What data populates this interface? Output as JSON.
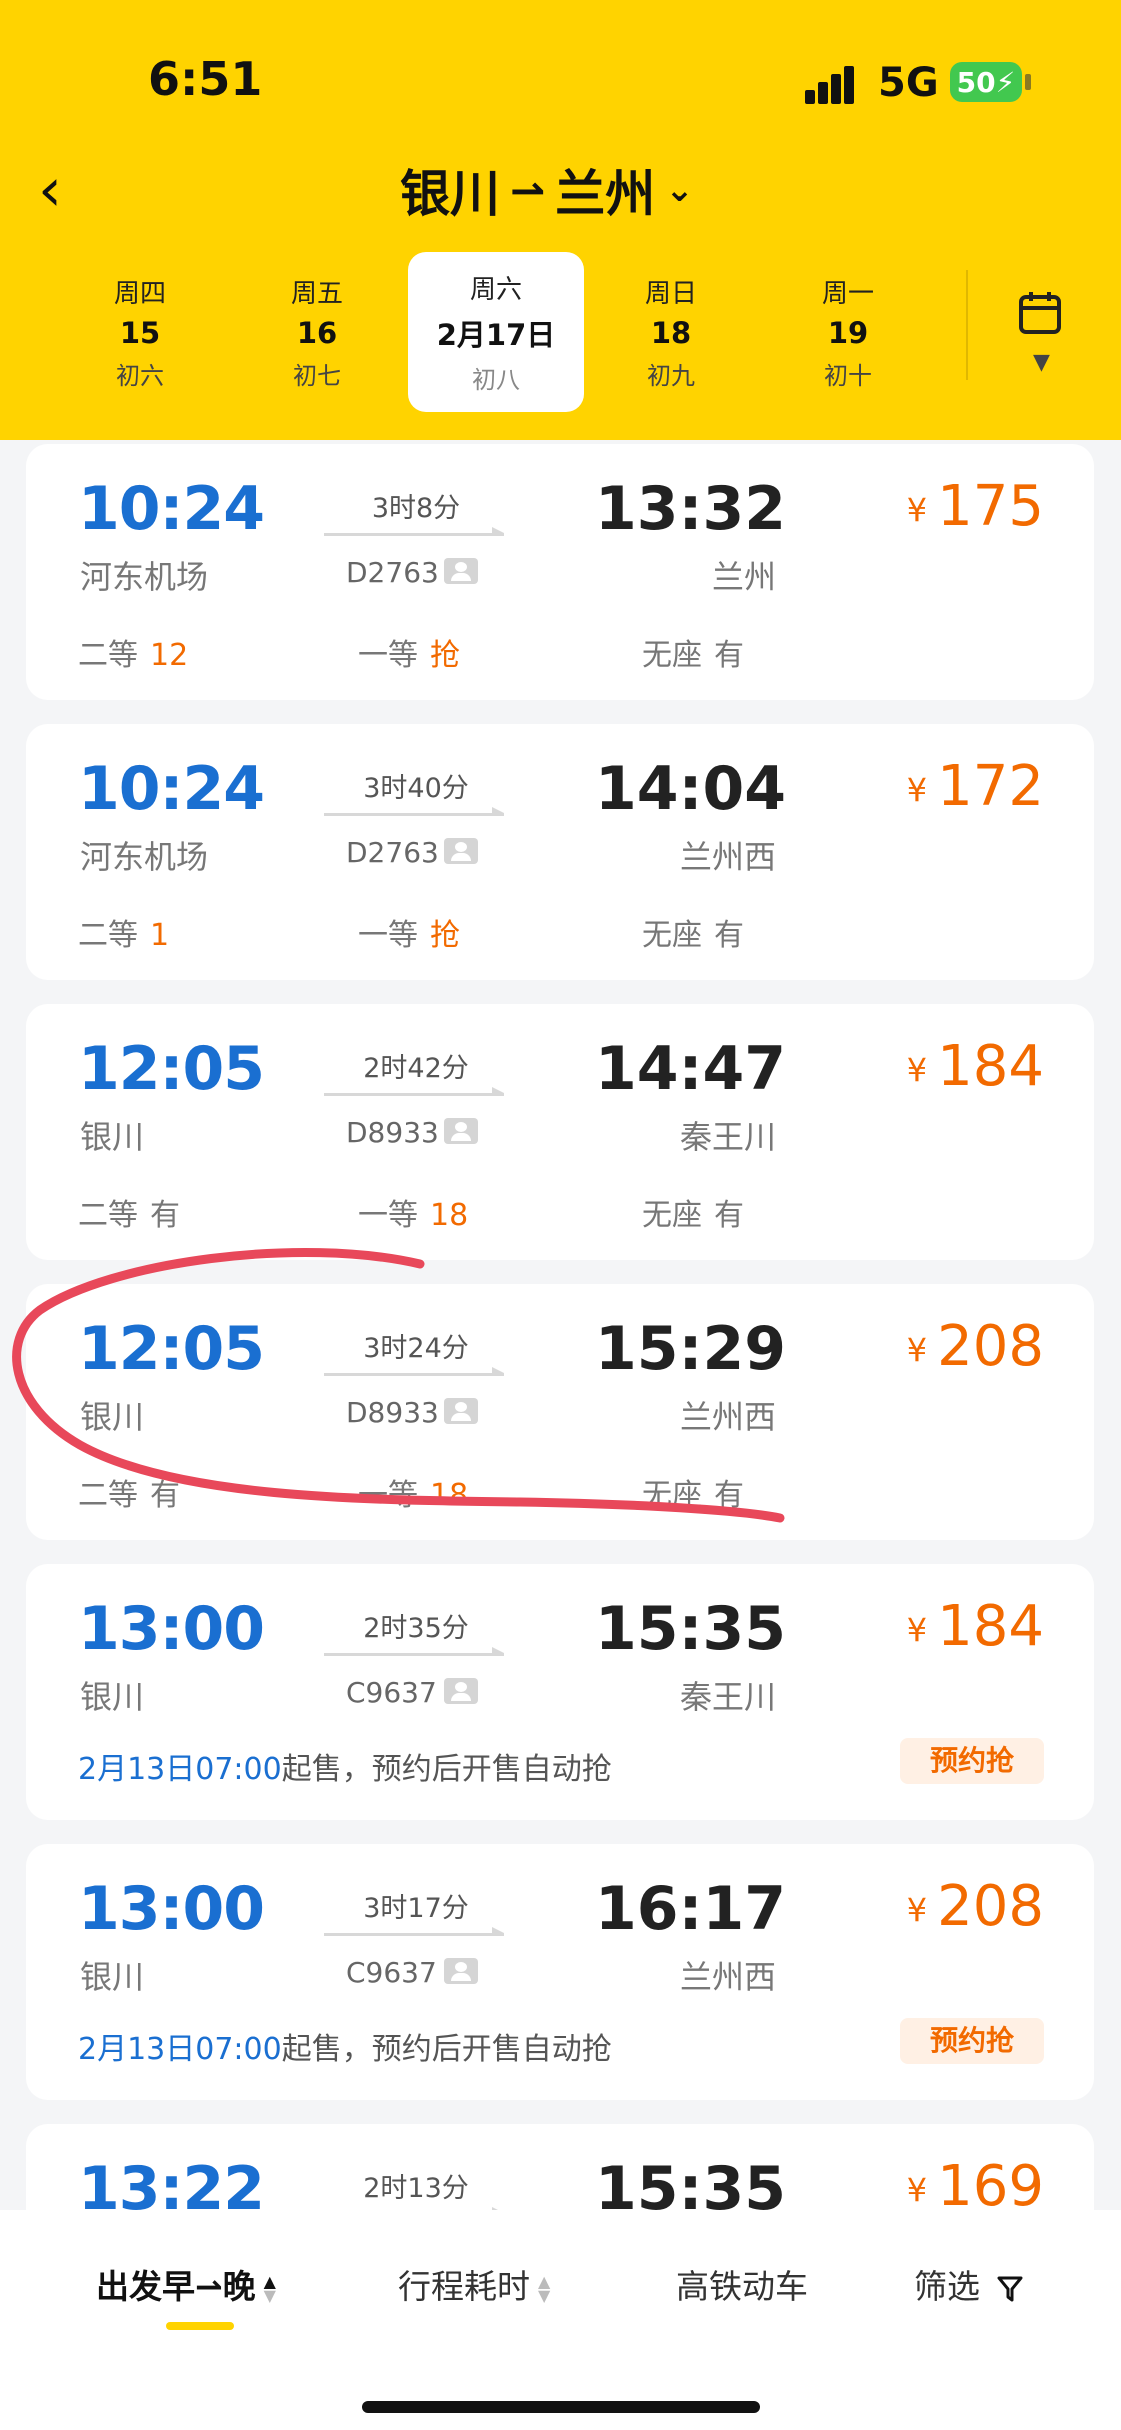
{
  "status": {
    "time": "6:51",
    "network": "5G",
    "battery": "50"
  },
  "header": {
    "from": "银川",
    "to": "兰州",
    "arrow": "⇀",
    "dates": [
      {
        "week": "周四",
        "day": "15",
        "lunar": "初六"
      },
      {
        "week": "周五",
        "day": "16",
        "lunar": "初七"
      },
      {
        "week": "周六",
        "day": "2月17日",
        "lunar": "初八",
        "selected": true
      },
      {
        "week": "周日",
        "day": "18",
        "lunar": "初九"
      },
      {
        "week": "周一",
        "day": "19",
        "lunar": "初十"
      }
    ]
  },
  "trains": [
    {
      "dep": "10:24",
      "from": "河东机场",
      "dur": "3时8分",
      "no": "D2763",
      "arr": "13:32",
      "to": "兰州",
      "price": "175",
      "seats": [
        {
          "cls": "二等",
          "v": "12"
        },
        {
          "cls": "一等",
          "v": "抢"
        },
        {
          "cls": "无座",
          "v": "有"
        }
      ]
    },
    {
      "dep": "10:24",
      "from": "河东机场",
      "dur": "3时40分",
      "no": "D2763",
      "arr": "14:04",
      "to": "兰州西",
      "price": "172",
      "seats": [
        {
          "cls": "二等",
          "v": "1"
        },
        {
          "cls": "一等",
          "v": "抢"
        },
        {
          "cls": "无座",
          "v": "有"
        }
      ]
    },
    {
      "dep": "12:05",
      "from": "银川",
      "dur": "2时42分",
      "no": "D8933",
      "arr": "14:47",
      "to": "秦王川",
      "price": "184",
      "seats": [
        {
          "cls": "二等",
          "v": "有"
        },
        {
          "cls": "一等",
          "v": "18"
        },
        {
          "cls": "无座",
          "v": "有"
        }
      ]
    },
    {
      "dep": "12:05",
      "from": "银川",
      "dur": "3时24分",
      "no": "D8933",
      "arr": "15:29",
      "to": "兰州西",
      "price": "208",
      "seats": [
        {
          "cls": "二等",
          "v": "有"
        },
        {
          "cls": "一等",
          "v": "18"
        },
        {
          "cls": "无座",
          "v": "有"
        }
      ]
    },
    {
      "dep": "13:00",
      "from": "银川",
      "dur": "2时35分",
      "no": "C9637",
      "arr": "15:35",
      "to": "秦王川",
      "price": "184",
      "sale_time": "2月13日07:00",
      "sale_text": "起售，预约后开售自动抢",
      "reserve": "预约抢"
    },
    {
      "dep": "13:00",
      "from": "银川",
      "dur": "3时17分",
      "no": "C9637",
      "arr": "16:17",
      "to": "兰州西",
      "price": "208",
      "sale_time": "2月13日07:00",
      "sale_text": "起售，预约后开售自动抢",
      "reserve": "预约抢"
    },
    {
      "dep": "13:22",
      "dur": "2时13分",
      "arr": "15:35",
      "price": "169"
    }
  ],
  "currency": "¥",
  "bottom_tabs": [
    "出发早⇀晚",
    "行程耗时",
    "高铁动车",
    "筛选"
  ],
  "colors": {
    "header": "#ffd300",
    "time_blue": "#1a6fd1",
    "price_orange": "#f26a00",
    "annotation_red": "#e8485a"
  }
}
